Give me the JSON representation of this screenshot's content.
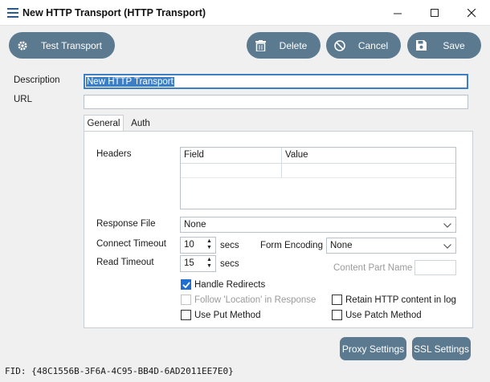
{
  "window": {
    "title": "New HTTP Transport (HTTP Transport)",
    "app_icon": "menu-icon",
    "controls": [
      "minimize-icon",
      "maximize-icon",
      "close-icon"
    ]
  },
  "toolbar": {
    "test_label": "Test Transport",
    "delete_label": "Delete",
    "cancel_label": "Cancel",
    "save_label": "Save",
    "button_color": "#5c7a8f"
  },
  "form": {
    "description_label": "Description",
    "description_value": "New HTTP Transport",
    "url_label": "URL",
    "url_value": ""
  },
  "tabs": [
    {
      "label": "General",
      "active": true
    },
    {
      "label": "Auth",
      "active": false
    }
  ],
  "general": {
    "headers_label": "Headers",
    "headers_columns": [
      "Field",
      "Value"
    ],
    "response_file_label": "Response File",
    "response_file_value": "None",
    "connect_timeout_label": "Connect Timeout",
    "connect_timeout_value": "10",
    "read_timeout_label": "Read Timeout",
    "read_timeout_value": "15",
    "secs_label": "secs",
    "form_encoding_label": "Form Encoding",
    "form_encoding_value": "None",
    "content_part_name_label": "Content Part Name",
    "content_part_name_value": "",
    "handle_redirects_label": "Handle Redirects",
    "handle_redirects_checked": true,
    "follow_location_label": "Follow 'Location' in Response",
    "follow_location_checked": false,
    "retain_http_label": "Retain HTTP content in log",
    "retain_http_checked": false,
    "use_put_label": "Use Put Method",
    "use_put_checked": false,
    "use_patch_label": "Use Patch Method",
    "use_patch_checked": false
  },
  "footer": {
    "proxy_label": "Proxy Settings",
    "ssl_label": "SSL Settings",
    "fid": "FID: {48C1556B-3F6A-4C95-BB4D-6AD2011EE7E0}"
  },
  "colors": {
    "accent": "#3c7fc4",
    "checkbox_checked": "#1f6fd1"
  }
}
